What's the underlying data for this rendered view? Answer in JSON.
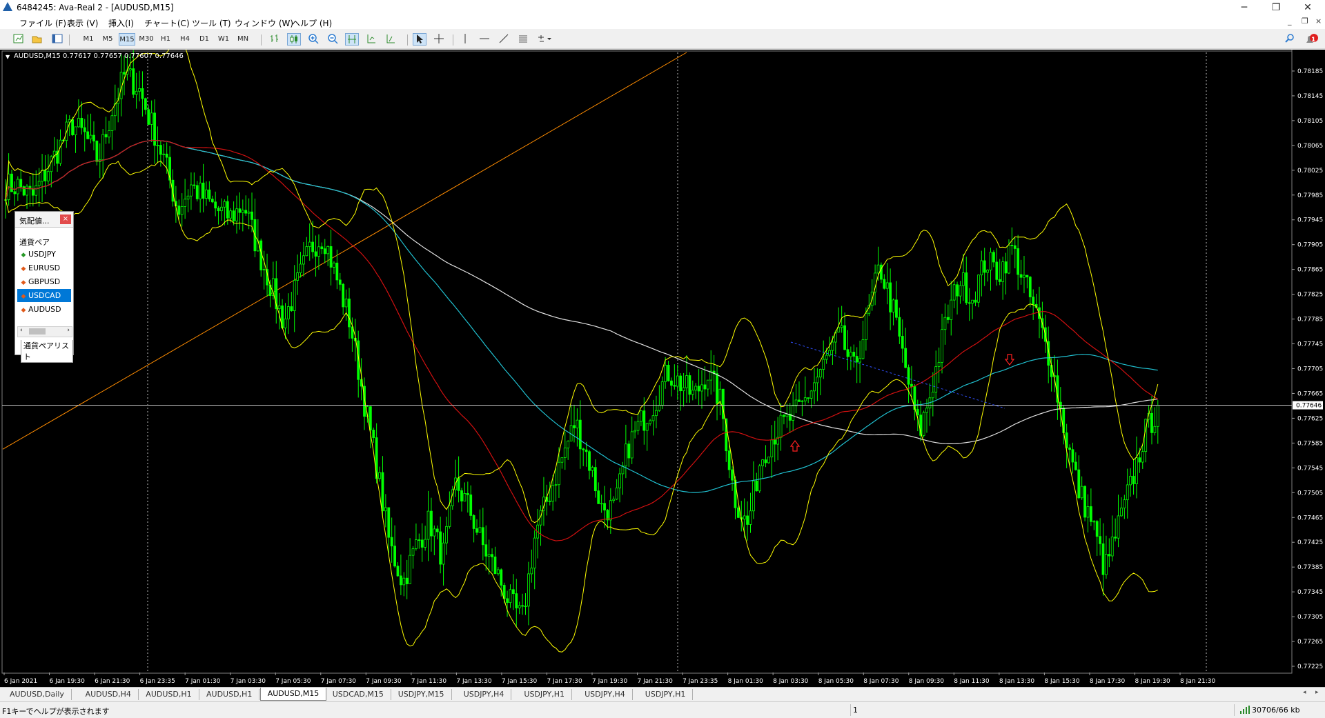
{
  "window": {
    "title": "6484245: Ava-Real 2 - [AUDUSD,M15]",
    "min_glyph": "─",
    "max_glyph": "❐",
    "close_glyph": "✕",
    "mdi_min": "_",
    "mdi_restore": "❐",
    "mdi_close": "×"
  },
  "menu": [
    "ファイル (F)",
    "表示 (V)",
    "挿入(I)",
    "チャート(C)",
    "ツール (T)",
    "ウィンドウ (W)",
    "ヘルプ (H)"
  ],
  "toolbar": {
    "timeframes": [
      "M1",
      "M5",
      "M15",
      "M30",
      "H1",
      "H4",
      "D1",
      "W1",
      "MN"
    ],
    "active_timeframe": "M15",
    "notification_count": "1"
  },
  "chart": {
    "info_label": "AUDUSD,M15  0.77617 0.77657 0.77607 0.77646",
    "current_price_label": "0.77646",
    "colors": {
      "background": "#000000",
      "candle": "#00ff00",
      "bands": "#ffff00",
      "ma_red": "#d01010",
      "ma_cyan": "#20c0d0",
      "ma_white": "#e0e0e0",
      "trendline": "#ff8c00"
    }
  },
  "chart_data": {
    "type": "candlestick",
    "symbol": "AUDUSD",
    "timeframe": "M15",
    "ohlc_last": {
      "open": 0.77617,
      "high": 0.77657,
      "low": 0.77607,
      "close": 0.77646
    },
    "y_ticks": [
      "0.78185",
      "0.78145",
      "0.78105",
      "0.78065",
      "0.78025",
      "0.77985",
      "0.77945",
      "0.77905",
      "0.77865",
      "0.77825",
      "0.77785",
      "0.77745",
      "0.77705",
      "0.77665",
      "0.77625",
      "0.77585",
      "0.77545",
      "0.77505",
      "0.77465",
      "0.77425",
      "0.77385",
      "0.77345",
      "0.77305",
      "0.77265",
      "0.77225"
    ],
    "x_ticks": [
      "6 Jan 2021",
      "6 Jan 19:30",
      "6 Jan 21:30",
      "6 Jan 23:35",
      "7 Jan 01:30",
      "7 Jan 03:30",
      "7 Jan 05:30",
      "7 Jan 07:30",
      "7 Jan 09:30",
      "7 Jan 11:30",
      "7 Jan 13:30",
      "7 Jan 15:30",
      "7 Jan 17:30",
      "7 Jan 19:30",
      "7 Jan 21:30",
      "7 Jan 23:35",
      "8 Jan 01:30",
      "8 Jan 03:30",
      "8 Jan 05:30",
      "8 Jan 07:30",
      "8 Jan 09:30",
      "8 Jan 11:30",
      "8 Jan 13:30",
      "8 Jan 15:30",
      "8 Jan 17:30",
      "8 Jan 19:30",
      "8 Jan 21:30"
    ],
    "ylim": [
      0.77215,
      0.78215
    ],
    "close_path": [
      0.78,
      0.78,
      0.7798,
      0.7802,
      0.7806,
      0.781,
      0.7808,
      0.7804,
      0.7812,
      0.7818,
      0.7816,
      0.781,
      0.7804,
      0.7796,
      0.78,
      0.7798,
      0.7796,
      0.7795,
      0.7797,
      0.779,
      0.7784,
      0.7778,
      0.7784,
      0.779,
      0.7792,
      0.7785,
      0.7778,
      0.7766,
      0.7755,
      0.7742,
      0.7736,
      0.7742,
      0.7746,
      0.774,
      0.7752,
      0.7748,
      0.7742,
      0.7738,
      0.7733,
      0.773,
      0.7744,
      0.775,
      0.7756,
      0.7762,
      0.7756,
      0.7748,
      0.7748,
      0.7758,
      0.7762,
      0.7765,
      0.777,
      0.7768,
      0.7766,
      0.777,
      0.7765,
      0.775,
      0.7745,
      0.7756,
      0.776,
      0.7762,
      0.7764,
      0.7768,
      0.7772,
      0.7776,
      0.777,
      0.7778,
      0.7787,
      0.778,
      0.777,
      0.776,
      0.7768,
      0.7778,
      0.7785,
      0.7782,
      0.7788,
      0.7786,
      0.779,
      0.7784,
      0.7778,
      0.7771,
      0.776,
      0.7751,
      0.7746,
      0.7738,
      0.7745,
      0.7752,
      0.776,
      0.7764
    ],
    "indicators": [
      "Bollinger Bands (yellow)",
      "Moving Average (red)",
      "Moving Average (cyan)",
      "Moving Average (white)",
      "Trendline (orange)"
    ]
  },
  "market_watch": {
    "title": "気配値...",
    "close_glyph": "×",
    "header": "通貨ペア",
    "items": [
      {
        "symbol": "USDJPY",
        "dir": "up",
        "selected": false
      },
      {
        "symbol": "EURUSD",
        "dir": "down",
        "selected": false
      },
      {
        "symbol": "GBPUSD",
        "dir": "down",
        "selected": false
      },
      {
        "symbol": "USDCAD",
        "dir": "down",
        "selected": true
      },
      {
        "symbol": "AUDUSD",
        "dir": "down",
        "selected": false
      }
    ],
    "tab_label": "通貨ペアリスト"
  },
  "tabs": {
    "items": [
      "AUDUSD,Daily",
      "AUDUSD,H4",
      "AUDUSD,H1",
      "AUDUSD,H1",
      "AUDUSD,M15",
      "USDCAD,M15",
      "USDJPY,M15",
      "USDJPY,H4",
      "USDJPY,H1",
      "USDJPY,H4",
      "USDJPY,H1"
    ],
    "active_index": 4
  },
  "status": {
    "help_text": "F1キーでヘルプが表示されます",
    "profile_text": "1",
    "traffic_text": "30706/66 kb"
  }
}
